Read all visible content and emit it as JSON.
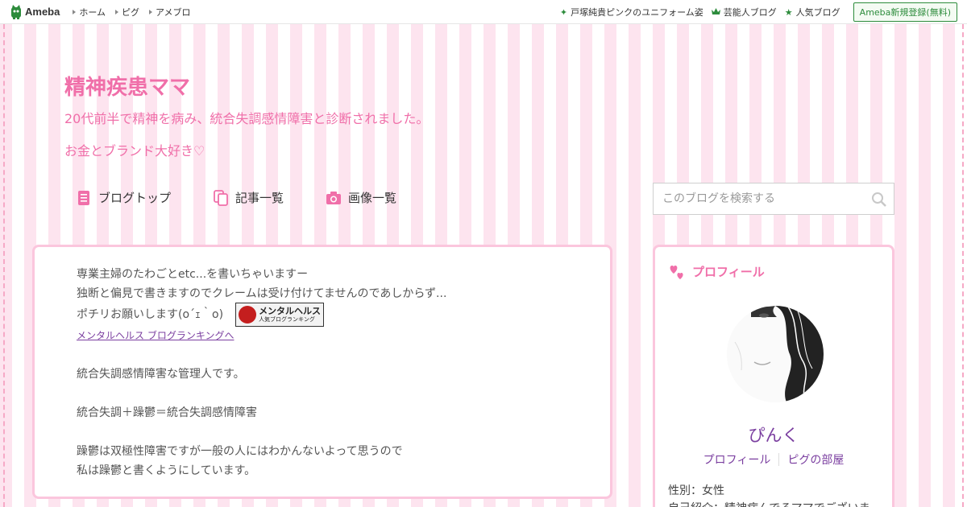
{
  "topbar": {
    "logo_text": "Ameba",
    "nav": [
      "ホーム",
      "ピグ",
      "アメブロ"
    ],
    "right_links": [
      {
        "icon": "sparkle-icon",
        "label": "戸塚純貴ピンクのユニフォーム姿"
      },
      {
        "icon": "crown-icon",
        "label": "芸能人ブログ"
      },
      {
        "icon": "star-icon",
        "label": "人気ブログ"
      }
    ],
    "register_label": "Ameba新規登録(無料)"
  },
  "header": {
    "title": "精神疾患ママ",
    "description_line1": "20代前半で精神を病み、統合失調感情障害と診断されました。",
    "description_line2": "お金とブランド大好き♡"
  },
  "gnav": {
    "top": "ブログトップ",
    "articles": "記事一覧",
    "images": "画像一覧"
  },
  "search": {
    "placeholder": "このブログを検索する"
  },
  "entry": {
    "line1": "専業主婦のたわごとetc...を書いちゃいますー",
    "line2": "独断と偏見で書きますのでクレームは受け付けてませんのであしからず...",
    "line3": "ポチリお願いします(o´ｪ｀o)",
    "banner_main": "メンタルヘルス",
    "banner_sub": "人気ブログランキング",
    "link": "メンタルヘルス ブログランキングへ",
    "para1": "統合失調感情障害な管理人です。",
    "para2": "統合失調＋躁鬱＝統合失調感情障害",
    "para3_line1": "躁鬱は双極性障害ですが一般の人にはわかんないよって思うので",
    "para3_line2": "私は躁鬱と書くようにしています。"
  },
  "profile": {
    "heading": "プロフィール",
    "name": "ぴんく",
    "link_profile": "プロフィール",
    "link_pigg": "ピグの部屋",
    "gender": "性別：女性",
    "intro": "自己紹介：精神病んでるママでございま"
  },
  "colors": {
    "accent_pink": "#f06fa9",
    "link_purple": "#7b3fa0",
    "ameba_green": "#2d8c3c"
  }
}
